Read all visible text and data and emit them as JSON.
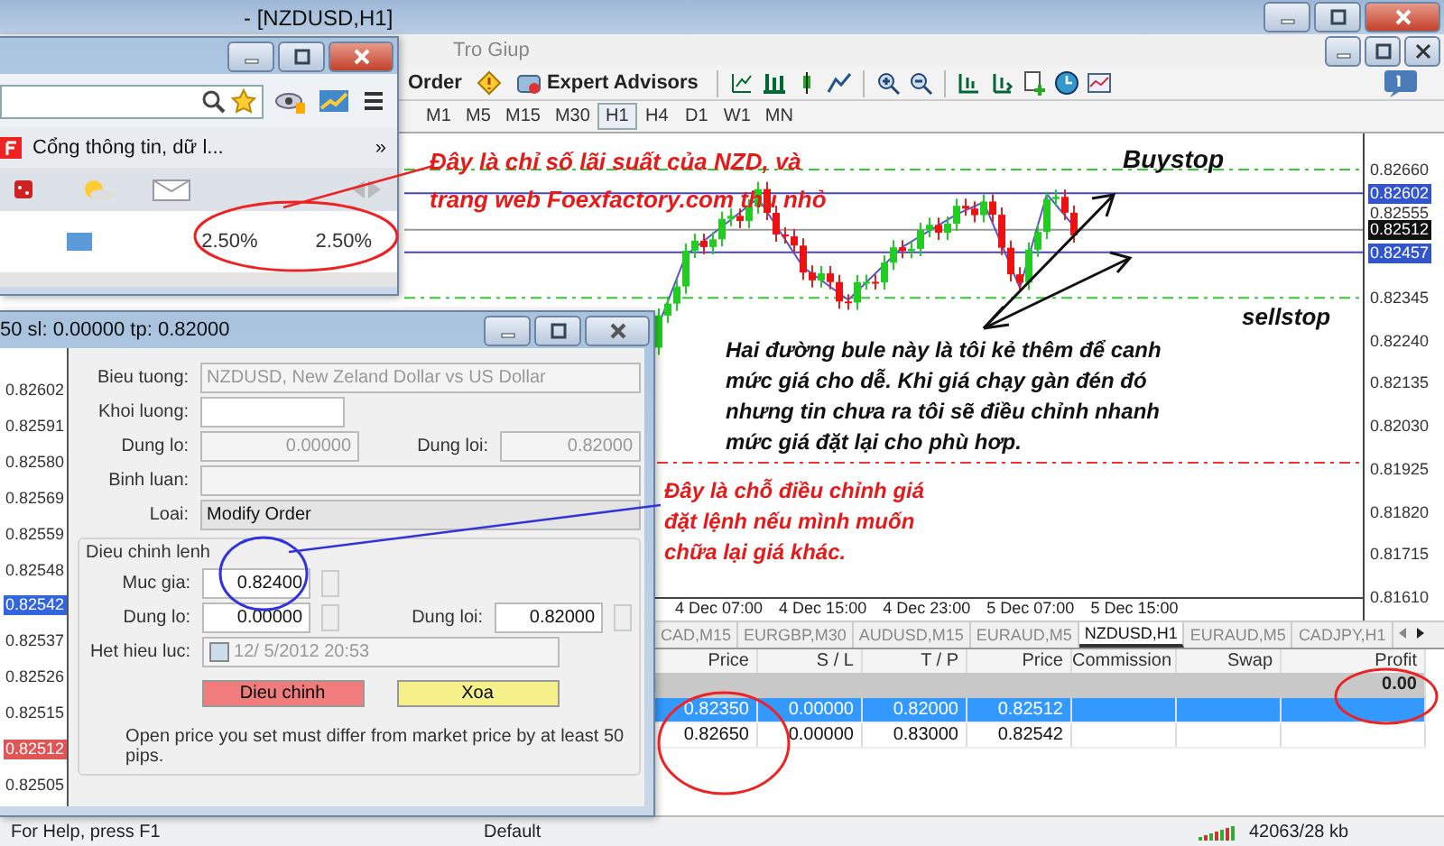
{
  "main_window": {
    "title": "- [NZDUSD,H1]"
  },
  "menu": [
    {
      "label": "Tro Giup"
    }
  ],
  "toolbar": {
    "buttons": [
      {
        "label": "Order",
        "kind": "order"
      },
      {
        "label": "Expert Advisors",
        "kind": "experts"
      }
    ]
  },
  "timeframes": [
    {
      "label": "M1",
      "selected": false
    },
    {
      "label": "M5",
      "selected": false
    },
    {
      "label": "M15",
      "selected": false
    },
    {
      "label": "M30",
      "selected": false
    },
    {
      "label": "H1",
      "selected": true
    },
    {
      "label": "H4",
      "selected": false
    },
    {
      "label": "D1",
      "selected": false
    },
    {
      "label": "W1",
      "selected": false
    },
    {
      "label": "MN",
      "selected": false
    }
  ],
  "chart": {
    "price_axis": [
      {
        "label": "0.82660",
        "kind": "tick"
      },
      {
        "label": "0.82602",
        "kind": "line"
      },
      {
        "label": "0.82555",
        "kind": "tick"
      },
      {
        "label": "0.82512",
        "kind": "bid"
      },
      {
        "label": "0.82457",
        "kind": "line"
      },
      {
        "label": "0.82345",
        "kind": "tick"
      },
      {
        "label": "0.82240",
        "kind": "tick"
      },
      {
        "label": "0.82135",
        "kind": "tick"
      },
      {
        "label": "0.82030",
        "kind": "tick"
      },
      {
        "label": "0.81925",
        "kind": "tick"
      },
      {
        "label": "0.81820",
        "kind": "tick"
      },
      {
        "label": "0.81715",
        "kind": "tick"
      },
      {
        "label": "0.81610",
        "kind": "tick"
      }
    ],
    "time_axis": [
      "4 Dec 07:00",
      "4 Dec 15:00",
      "4 Dec 23:00",
      "5 Dec 07:00",
      "5 Dec 15:00"
    ]
  },
  "chart_tabs": [
    {
      "label": "CAD,M15",
      "selected": false
    },
    {
      "label": "EURGBP,M30",
      "selected": false
    },
    {
      "label": "AUDUSD,M15",
      "selected": false
    },
    {
      "label": "EURAUD,M5",
      "selected": false
    },
    {
      "label": "NZDUSD,H1",
      "selected": true
    },
    {
      "label": "EURAUD,M5",
      "selected": false
    },
    {
      "label": "CADJPY,H1",
      "selected": false
    }
  ],
  "terminal": {
    "columns": [
      "Price",
      "S / L",
      "T / P",
      "Price",
      "Commission",
      "Swap",
      "Profit"
    ],
    "summary_profit": "0.00",
    "rows": [
      {
        "selected": true,
        "cells": [
          "0.82350",
          "0.00000",
          "0.82000",
          "0.82512"
        ]
      },
      {
        "selected": false,
        "cells": [
          "0.82650",
          "0.00000",
          "0.83000",
          "0.82542"
        ]
      }
    ]
  },
  "status_bar": [
    "For Help, press F1",
    "Default",
    "42063/28 kb"
  ],
  "browser": {
    "bookmark": "Cổng thông tin, dữ l...",
    "overflow": "»",
    "rates": [
      "2.50%",
      "2.50%"
    ]
  },
  "order_dialog": {
    "title": "50 sl: 0.00000 tp: 0.82000",
    "tick_axis": [
      {
        "label": "0.82602",
        "kind": "tick"
      },
      {
        "label": "0.82591",
        "kind": "tick"
      },
      {
        "label": "0.82580",
        "kind": "tick"
      },
      {
        "label": "0.82569",
        "kind": "tick"
      },
      {
        "label": "0.82559",
        "kind": "tick"
      },
      {
        "label": "0.82548",
        "kind": "tick"
      },
      {
        "label": "0.82542",
        "kind": "ask"
      },
      {
        "label": "0.82537",
        "kind": "tick"
      },
      {
        "label": "0.82526",
        "kind": "tick"
      },
      {
        "label": "0.82515",
        "kind": "tick"
      },
      {
        "label": "0.82512",
        "kind": "bid"
      },
      {
        "label": "0.82505",
        "kind": "tick"
      }
    ],
    "symbol": {
      "label": "Bieu tuong:",
      "value": "NZDUSD, New Zeland Dollar vs US Dollar",
      "disabled": true
    },
    "volume": {
      "label": "Khoi luong:"
    },
    "stop_loss": {
      "label": "Dung lo:",
      "value": "0.00000",
      "disabled": true
    },
    "take_profit": {
      "label": "Dung loi:",
      "value": "0.82000",
      "disabled": true
    },
    "comment": {
      "label": "Binh luan:"
    },
    "type": {
      "label": "Loai:",
      "value": "Modify Order"
    },
    "group": {
      "title": "Dieu chinh lenh",
      "price": {
        "label": "Muc gia:",
        "value": "0.82400"
      },
      "stop_loss": {
        "label": "Dung lo:",
        "value": "0.00000"
      },
      "take_profit": {
        "label": "Dung loi:",
        "value": "0.82000"
      },
      "expiry": {
        "label": "Het hieu luc:",
        "value": "12/ 5/2012 20:53",
        "checked": false
      }
    },
    "buttons": [
      {
        "label": "Dieu chinh",
        "kind": "modify"
      },
      {
        "label": "Xoa",
        "kind": "delete"
      }
    ],
    "note": "Open price you set must differ from market price by at least 50 pips."
  },
  "annotations": {
    "rate_note": "Đây là chỉ số lãi suất của NZD, và trang web Foexfactory.com thu nhỏ",
    "buystop": "Buystop",
    "sellstop": "sellstop",
    "lines_note": "Hai đường bule này là tôi kẻ thêm để canh mức giá cho dễ. Khi giá chạy gàn đén đó nhưng tin chưa ra tôi sẽ điều chỉnh nhanh mức giá đặt lại cho phù hơp.",
    "price_note": "Đây là chỗ điều chỉnh giá đặt lệnh nếu mình muốn chữa lại giá khác."
  }
}
